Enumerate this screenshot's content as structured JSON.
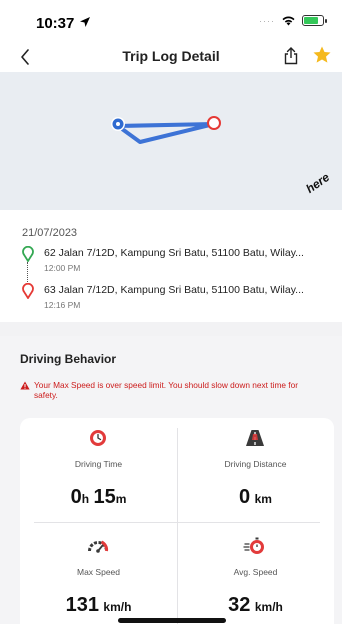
{
  "status_bar": {
    "time": "10:37"
  },
  "header": {
    "title": "Trip Log Detail"
  },
  "map": {
    "attribution": "here"
  },
  "trip": {
    "date": "21/07/2023",
    "start": {
      "address": "62 Jalan 7/12D, Kampung Sri Batu, 51100 Batu, Wilay...",
      "time": "12:00 PM"
    },
    "end": {
      "address": "63 Jalan 7/12D, Kampung Sri Batu, 51100 Batu, Wilay...",
      "time": "12:16 PM"
    }
  },
  "driving_behavior": {
    "title": "Driving Behavior",
    "warning": "Your Max Speed is over speed limit. You should slow down next time for safety.",
    "stats": {
      "driving_time": {
        "label": "Driving Time",
        "hours": "0",
        "hours_unit": "h",
        "minutes": "15",
        "minutes_unit": "m"
      },
      "driving_distance": {
        "label": "Driving Distance",
        "value": "0",
        "unit": "km"
      },
      "max_speed": {
        "label": "Max Speed",
        "value": "131",
        "unit": "km/h"
      },
      "avg_speed": {
        "label": "Avg. Speed",
        "value": "32",
        "unit": "km/h"
      }
    }
  },
  "icons": {
    "back": "chevron-left-icon",
    "share": "share-icon",
    "favorite": "star-icon",
    "driving_time": "clock-icon",
    "driving_distance": "road-icon",
    "max_speed": "speedometer-icon",
    "avg_speed": "stopwatch-icon",
    "warning": "warning-triangle-icon"
  },
  "colors": {
    "route": "#3d73d6",
    "start_pin": "#34a853",
    "end_pin": "#e53935",
    "warning_text": "#cc1c1c",
    "favorite_star": "#f5b91d"
  }
}
